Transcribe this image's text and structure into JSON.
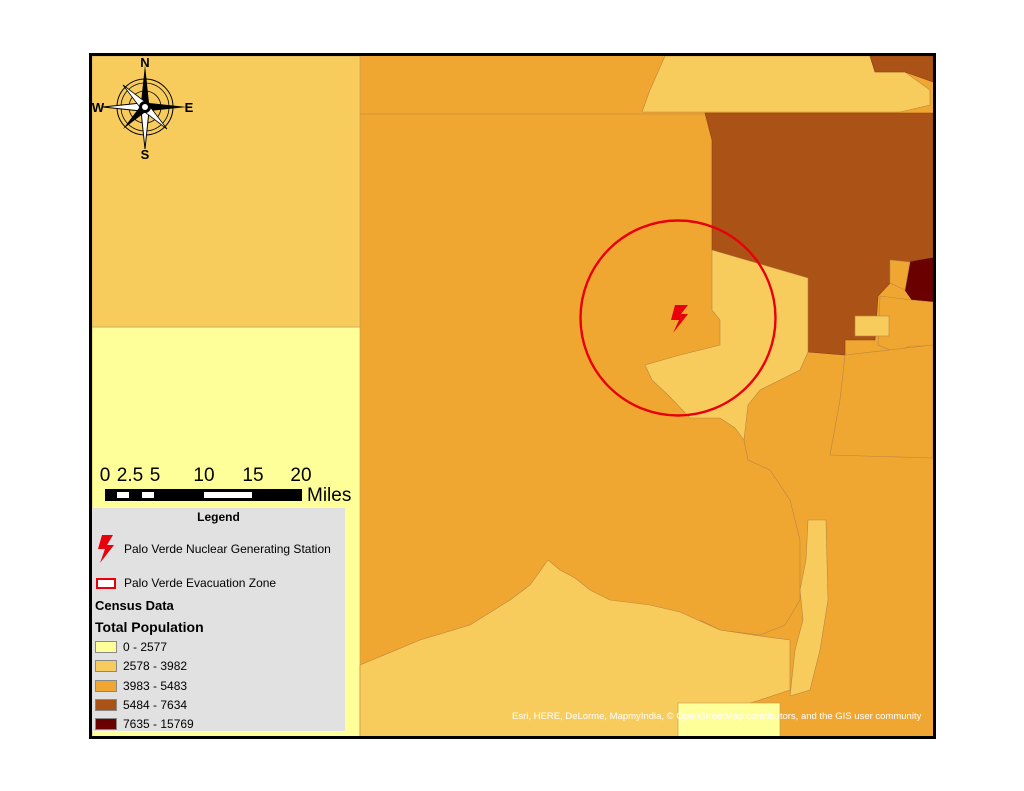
{
  "compass": {
    "north": "N",
    "south": "S",
    "east": "E",
    "west": "W"
  },
  "scale_bar": {
    "ticks": [
      "0",
      "2.5",
      "5",
      "10",
      "15",
      "20"
    ],
    "unit": "Miles"
  },
  "legend": {
    "title": "Legend",
    "station_label": "Palo Verde Nuclear Generating Station",
    "zone_label": "Palo Verde Evacuation Zone",
    "census_heading": "Census Data",
    "population_heading": "Total Population",
    "classes": [
      {
        "range": "0 - 2577",
        "color": "#ffff99"
      },
      {
        "range": "2578 - 3982",
        "color": "#f8cc5c"
      },
      {
        "range": "3983 - 5483",
        "color": "#f0a732"
      },
      {
        "range": "5484 - 7634",
        "color": "#ab5217"
      },
      {
        "range": "7635 - 15769",
        "color": "#6b0000"
      }
    ]
  },
  "symbols": {
    "station_color": "#e8000b",
    "zone_color": "#e8000b",
    "station_icon": "lightning-bolt-icon"
  },
  "attribution": "Esri, HERE, DeLorme, MapmyIndia, © OpenStreetMap contributors, and the GIS user community"
}
